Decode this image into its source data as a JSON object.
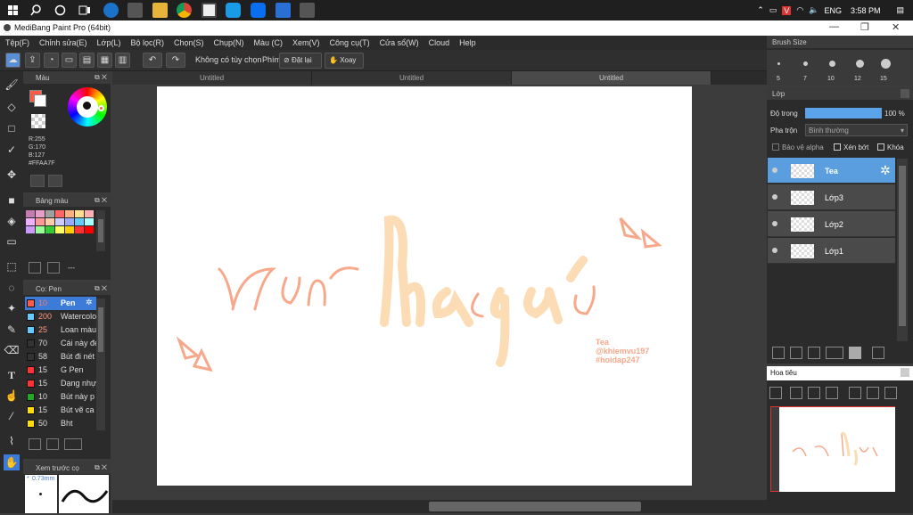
{
  "taskbar": {
    "tray": {
      "lang": "ENG",
      "time": "3:58 PM"
    },
    "icons": [
      "windows-icon",
      "search-icon",
      "cortana-icon",
      "taskview-icon",
      "edge-icon",
      "store-icon",
      "explorer-icon",
      "chrome-icon",
      "medibang-icon",
      "skype-icon",
      "zalo-icon",
      "photos-icon",
      "camera-icon"
    ]
  },
  "window": {
    "title": "MediBang Paint Pro (64bit)",
    "min": "—",
    "max": "❐",
    "close": "✕"
  },
  "menu": [
    "Tệp(F)",
    "Chỉnh sửa(E)",
    "Lớp(L)",
    "Bộ lọc(R)",
    "Chọn(S)",
    "Chụp(N)",
    "Màu (C)",
    "Xem(V)",
    "Công cụ(T)",
    "Cửa sổ(W)",
    "Cloud",
    "Help"
  ],
  "toolbar": {
    "no_option": "Không có tùy chọn",
    "shortcut": "Phím",
    "reset": "Đặt lại",
    "rotate": "Xoay"
  },
  "tabs": [
    "Untitled",
    "Untitled",
    "Untitled"
  ],
  "color_panel": {
    "title": "Màu",
    "r": "R:255",
    "g": "G:170",
    "b": "B:127",
    "hex": "#FFAA7F",
    "fg": "#ff5a46",
    "bg": "#ffffff"
  },
  "palette_panel": {
    "title": "Bảng màu",
    "colors": [
      "#c47bb0",
      "#e6a0c8",
      "#a0a0a0",
      "#ff6666",
      "#ffb080",
      "#ffe090",
      "#ffb0b0",
      "#f0b0ff",
      "#ff9999",
      "#ffccaa",
      "#ccccff",
      "#99aaff",
      "#66ccff",
      "#aaffff",
      "#cc99ff",
      "#99ff99",
      "#33cc33",
      "#ffff66",
      "#ffcc00",
      "#ff3333",
      "#ff0000"
    ],
    "counter": "---"
  },
  "brush_panel": {
    "title": "Cọ: Pen",
    "brushes": [
      {
        "color": "#ff5a46",
        "size": "10",
        "name": "Pen",
        "active": true
      },
      {
        "color": "#66ccff",
        "size": "200",
        "name": "Watercolor",
        "active": false
      },
      {
        "color": "#66ccff",
        "size": "25",
        "name": "Loan màu",
        "active": false
      },
      {
        "color": "#333333",
        "size": "70",
        "name": "Cái này đẹp",
        "active": false
      },
      {
        "color": "#333333",
        "size": "58",
        "name": "Bút đi nét",
        "active": false
      },
      {
        "color": "#ff3333",
        "size": "15",
        "name": "G Pen",
        "active": false
      },
      {
        "color": "#ff3333",
        "size": "15",
        "name": "Dạng nhựa",
        "active": false
      },
      {
        "color": "#22aa22",
        "size": "10",
        "name": "Bút này p",
        "active": false
      },
      {
        "color": "#ffdd00",
        "size": "15",
        "name": "Bút vẽ ca",
        "active": false
      },
      {
        "color": "#ffdd00",
        "size": "50",
        "name": "Bht",
        "active": false
      }
    ]
  },
  "preview_panel": {
    "title": "Xem trước cọ",
    "size": "0.73mm"
  },
  "brush_size_panel": {
    "title": "Brush Size",
    "sizes": [
      "5",
      "7",
      "10",
      "12",
      "15"
    ]
  },
  "layer_panel": {
    "title": "Lớp",
    "opacity_label": "Độ trong",
    "opacity_value": 100,
    "opacity_text": "100 %",
    "blend_label": "Pha trộn",
    "blend_value": "Bình thường",
    "protect_alpha": "Bảo vệ alpha",
    "clipping": "Xén bớt",
    "lock": "Khóa",
    "layers": [
      {
        "name": "Tea",
        "selected": true
      },
      {
        "name": "Lớp3",
        "selected": false
      },
      {
        "name": "Lớp2",
        "selected": false
      },
      {
        "name": "Lớp1",
        "selected": false
      }
    ]
  },
  "navigator_panel": {
    "title": "Hoa tiêu"
  },
  "canvas_art": {
    "main_text": "Hảnh quá",
    "signature_lines": [
      "Tea",
      "@khiemvu197",
      "#hoidap247"
    ],
    "stroke_color": "#f7a88a",
    "fill_color": "#fcdcb4"
  }
}
